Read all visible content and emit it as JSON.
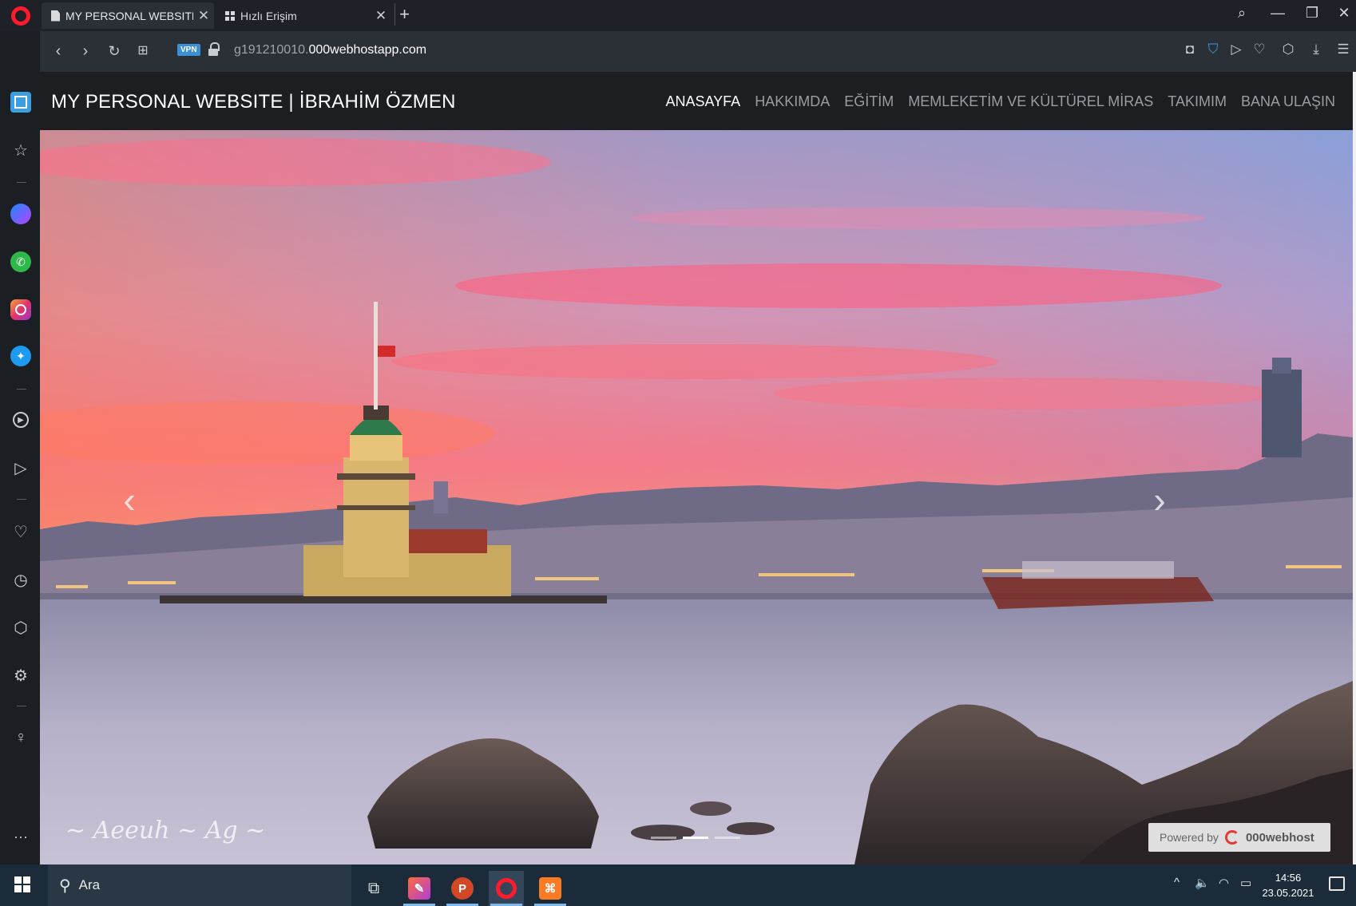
{
  "browser": {
    "tabs": [
      {
        "label": "MY PERSONAL WEBSITE | İl",
        "active": true
      },
      {
        "label": "Hızlı Erişim",
        "active": false
      }
    ],
    "new_tab_symbol": "+",
    "address": {
      "vpn_badge": "VPN",
      "url_prefix": "g191210010.",
      "url_domain": "000webhostapp.com"
    },
    "toolbar_icons": [
      "camera-icon",
      "shield-icon",
      "send-icon",
      "heart-icon",
      "cube-icon",
      "download-icon",
      "menu-icon"
    ],
    "sidebar_icons": [
      "home-icon",
      "star-icon",
      "messenger-icon",
      "whatsapp-icon",
      "instagram-icon",
      "twitter-icon",
      "player-icon",
      "send-icon",
      "heart-icon",
      "history-icon",
      "cube-icon",
      "settings-icon",
      "bulb-icon",
      "more-icon"
    ]
  },
  "site": {
    "brand": "MY PERSONAL WEBSITE | İBRAHİM ÖZMEN",
    "menu": [
      {
        "label": "ANASAYFA",
        "active": true
      },
      {
        "label": "HAKKIMDA",
        "active": false
      },
      {
        "label": "EĞİTİM",
        "active": false
      },
      {
        "label": "MEMLEKETİM VE KÜLTÜREL MİRAS",
        "active": false
      },
      {
        "label": "TAKIMIM",
        "active": false
      },
      {
        "label": "BANA ULAŞIN",
        "active": false
      }
    ],
    "carousel": {
      "prev_symbol": "‹",
      "next_symbol": "›",
      "slide_count": 3,
      "active_slide": 2
    },
    "powered": {
      "prefix": "Powered by",
      "name": "000webhost"
    }
  },
  "taskbar": {
    "search_placeholder": "Ara",
    "time": "14:56",
    "date": "23.05.2021",
    "app_icons": [
      "task-view-icon",
      "paint-app-icon",
      "powerpoint-icon",
      "opera-icon",
      "xampp-icon"
    ]
  },
  "colors": {
    "accent": "#3a9ee0",
    "header_bg": "#1c1e21",
    "menu_inactive": "#9a9da2"
  }
}
